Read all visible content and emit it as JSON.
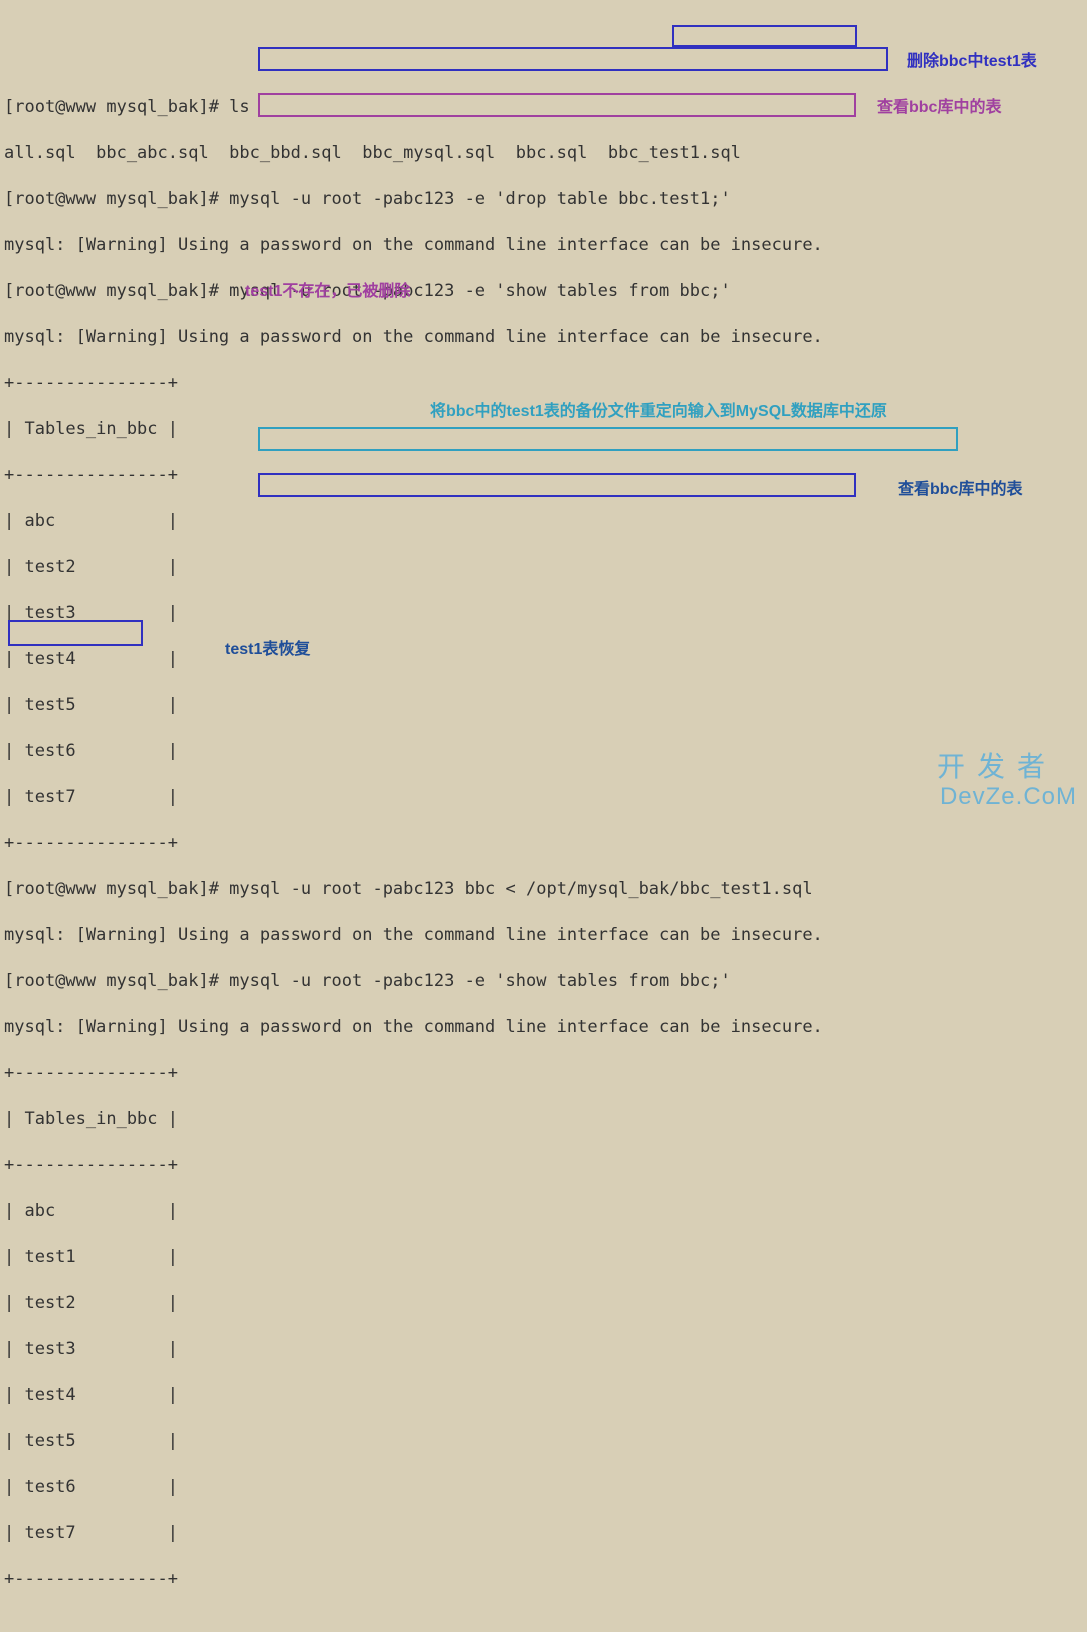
{
  "lines": {
    "l1_prompt": "[root@www mysql_bak]# ",
    "l1_cmd": "ls",
    "l2": "all.sql  bbc_abc.sql  bbc_bbd.sql  bbc_mysql.sql  bbc.sql  bbc_test1.sql",
    "l3_prompt": "[root@www mysql_bak]# ",
    "l3_cmd": "mysql -u root -pabc123 -e 'drop table bbc.test1;'",
    "l4": "mysql: [Warning] Using a password on the command line interface can be insecure.",
    "l5_prompt": "[root@www mysql_bak]# ",
    "l5_cmd": "mysql -u root -pabc123 -e 'show tables from bbc;'",
    "l6": "mysql: [Warning] Using a password on the command line interface can be insecure.",
    "l7": "+---------------+",
    "l8": "| Tables_in_bbc |",
    "l9": "+---------------+",
    "l10": "| abc           |",
    "l11": "| test2         |",
    "l12": "| test3         |",
    "l13": "| test4         |",
    "l14": "| test5         |",
    "l15": "| test6         |",
    "l16": "| test7         |",
    "l17": "+---------------+",
    "l18_prompt": "[root@www mysql_bak]# ",
    "l18_cmd": "mysql -u root -pabc123 bbc < /opt/mysql_bak/bbc_test1.sql",
    "l19": "mysql: [Warning] Using a password on the command line interface can be insecure.",
    "l20_prompt": "[root@www mysql_bak]# ",
    "l20_cmd": "mysql -u root -pabc123 -e 'show tables from bbc;'",
    "l21": "mysql: [Warning] Using a password on the command line interface can be insecure.",
    "l22": "+---------------+",
    "l23": "| Tables_in_bbc |",
    "l24": "+---------------+",
    "l25": "| abc           |",
    "l26": "| test1         |",
    "l27": "| test2         |",
    "l28": "| test3         |",
    "l29": "| test4         |",
    "l30": "| test5         |",
    "l31": "| test6         |",
    "l32": "| test7         |",
    "l33": "+---------------+"
  },
  "annotations": {
    "a1": "删除bbc中test1表",
    "a2": "查看bbc库中的表",
    "a3": "test1不存在，已被删除",
    "a4": "将bbc中的test1表的备份文件重定向输入到MySQL数据库中还原",
    "a5": "查看bbc库中的表",
    "a6": "test1表恢复"
  },
  "watermark": {
    "w1": "开发者",
    "w2": "DevZe.CoM"
  }
}
